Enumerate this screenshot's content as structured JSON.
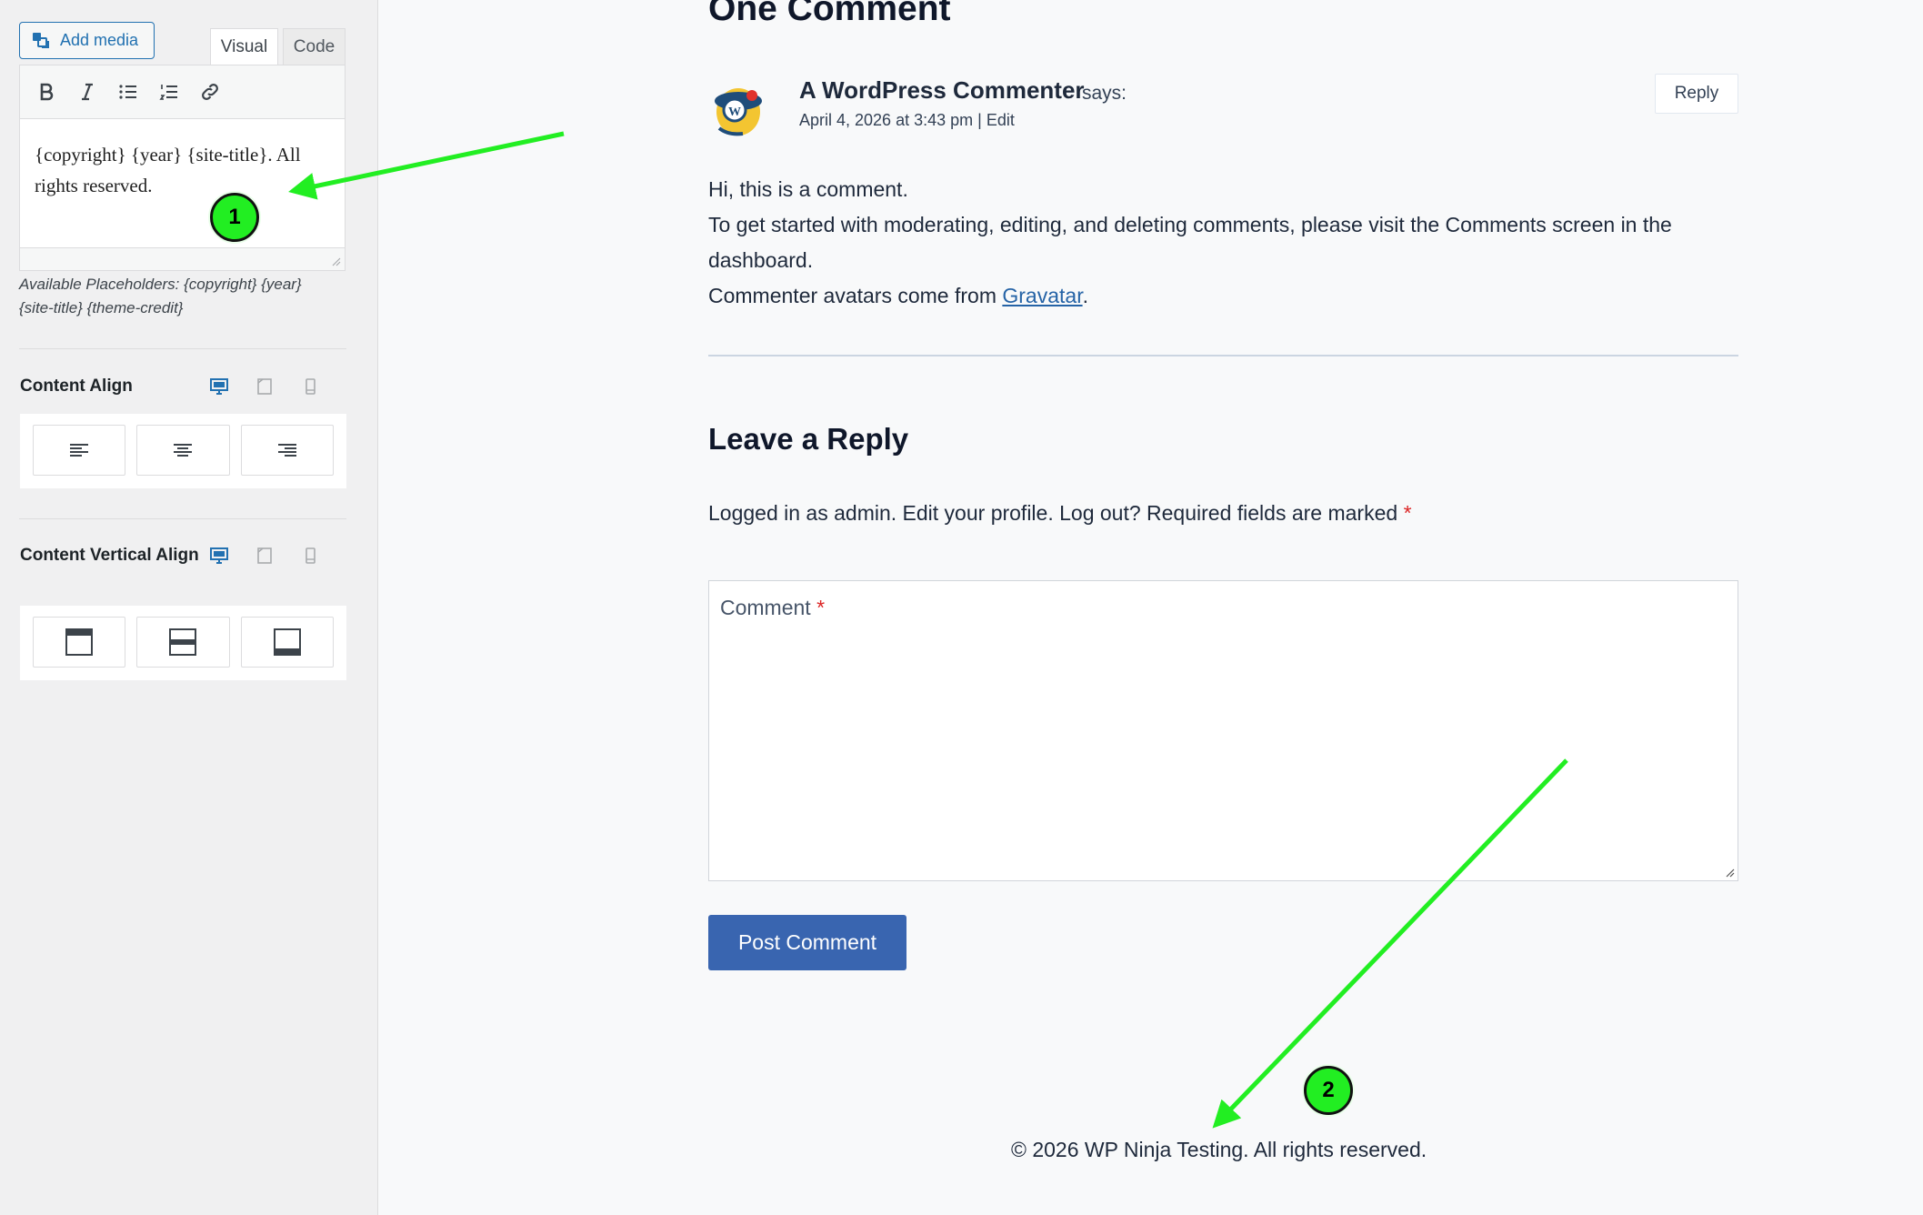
{
  "sidebar": {
    "add_media_label": "Add media",
    "tabs": {
      "visual": "Visual",
      "code": "Code"
    },
    "editor_text": "{copyright} {year} {site-title}. All rights reserved.",
    "placeholders_hint": "Available Placeholders: {copyright} {year} {site-title} {theme-credit}",
    "content_align_title": "Content Align",
    "content_valign_title": "Content Vertical Align"
  },
  "comments": {
    "heading": "One Comment",
    "author": "A WordPress Commenter",
    "says": "says:",
    "date": "April 4, 2026 at 3:43 pm",
    "separator": "|",
    "edit_label": "Edit",
    "reply_label": "Reply",
    "body_line1": "Hi, this is a comment.",
    "body_line2": "To get started with moderating, editing, and deleting comments, please visit the Comments screen in the dashboard.",
    "body_line3_prefix": "Commenter avatars come from ",
    "gravatar_link": "Gravatar",
    "body_line3_suffix": "."
  },
  "reply_form": {
    "heading": "Leave a Reply",
    "logged_in_text": "Logged in as admin. Edit your profile. Log out? Required fields are marked",
    "required_mark": "*",
    "comment_label": "Comment",
    "submit_label": "Post Comment"
  },
  "footer": {
    "text": "© 2026 WP Ninja Testing. All rights reserved."
  },
  "annotations": {
    "marker_1": "1",
    "marker_2": "2",
    "arrow_color": "#22ee22"
  },
  "colors": {
    "accent": "#2271b1",
    "button": "#3965b0",
    "required": "#dc2626",
    "link": "#2563a6"
  },
  "icons": [
    "add-media-icon",
    "bold-icon",
    "italic-icon",
    "bullet-list-icon",
    "numbered-list-icon",
    "link-icon",
    "desktop-icon",
    "tablet-icon",
    "mobile-icon",
    "align-left-icon",
    "align-center-icon",
    "align-right-icon",
    "valign-top-icon",
    "valign-middle-icon",
    "valign-bottom-icon",
    "resize-grip-icon"
  ]
}
